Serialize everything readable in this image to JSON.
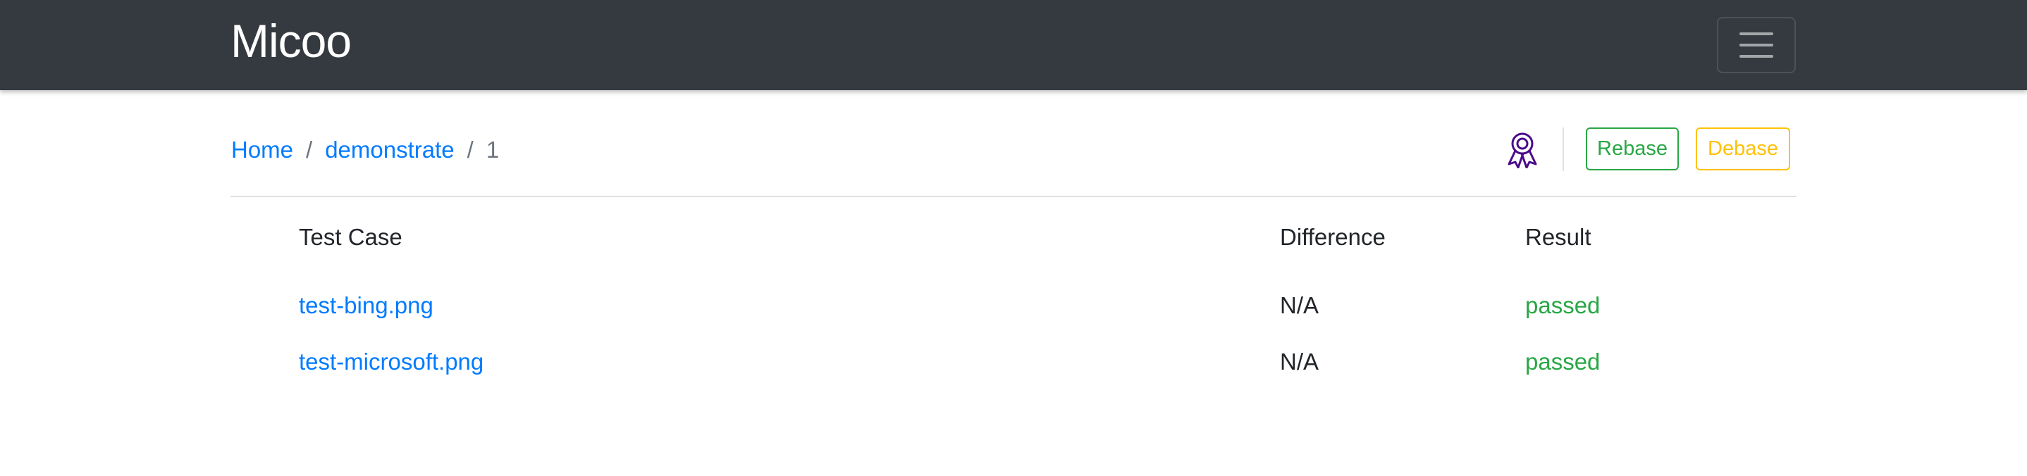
{
  "navbar": {
    "brand": "Micoo",
    "toggler_icon": "hamburger-menu-icon"
  },
  "breadcrumb": {
    "home": "Home",
    "project": "demonstrate",
    "build": "1",
    "separator": "/"
  },
  "actions": {
    "award_icon": "award-ribbon-icon",
    "rebase_label": "Rebase",
    "debase_label": "Debase"
  },
  "table": {
    "headers": [
      "Test Case",
      "Difference",
      "Result"
    ],
    "rows": [
      {
        "test_case": "test-bing.png",
        "difference": "N/A",
        "result": "passed"
      },
      {
        "test_case": "test-microsoft.png",
        "difference": "N/A",
        "result": "passed"
      }
    ]
  },
  "colors": {
    "navbar_bg": "#343a40",
    "link": "#007bff",
    "success": "#28a745",
    "warning": "#ffc107",
    "award_icon": "#4b0b8a"
  }
}
